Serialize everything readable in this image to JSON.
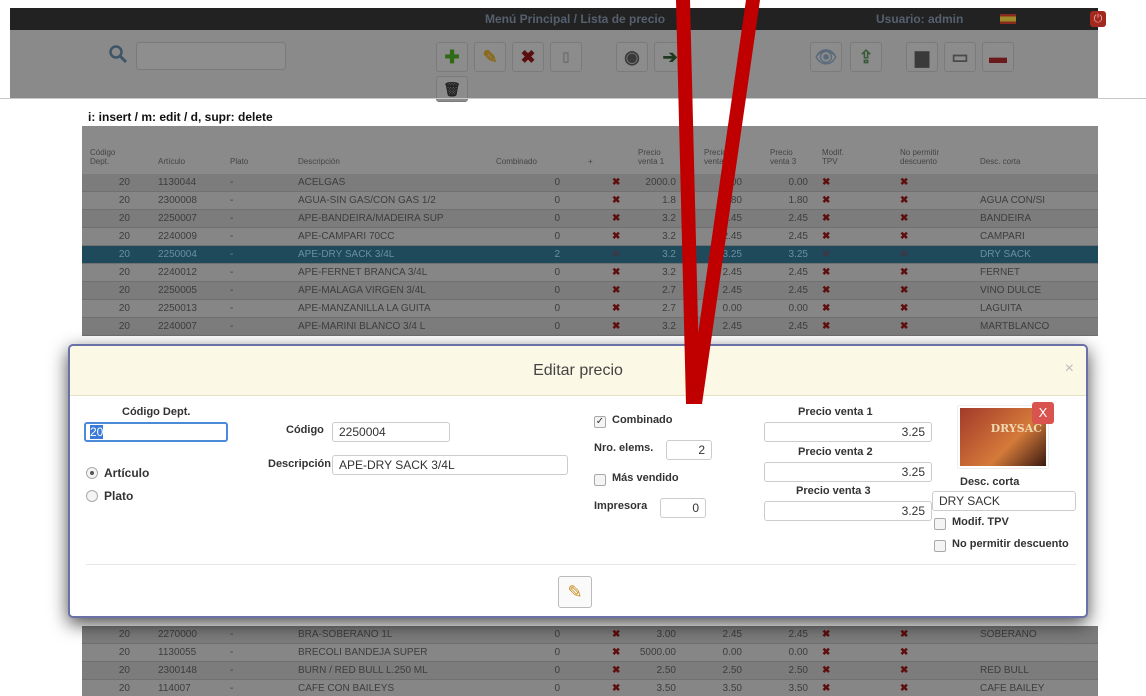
{
  "topbar": {
    "title": "Menú Principal / Lista de precio",
    "user": "Usuario: admin"
  },
  "hint": "i: insert / m: edit / d, supr: delete",
  "table": {
    "headers": [
      "Código Dept.",
      "Artículo",
      "Plato",
      "Descripción",
      "Combinado",
      "+",
      "Precio venta 1",
      "Precio venta 2",
      "Precio venta 3",
      "Modif. TPV",
      "No permitir descuento",
      "Desc. corta"
    ],
    "rows": [
      {
        "dept": "20",
        "art": "1130044",
        "plato": "-",
        "desc": "ACELGAS",
        "comb": "0",
        "p1": "2000.0",
        "p2": "0.00",
        "p3": "0.00",
        "corta": ""
      },
      {
        "dept": "20",
        "art": "2300008",
        "plato": "-",
        "desc": "AGUA-SIN GAS/CON GAS 1/2",
        "comb": "0",
        "p1": "1.8",
        "p2": "1.80",
        "p3": "1.80",
        "corta": "AGUA CON/SI"
      },
      {
        "dept": "20",
        "art": "2250007",
        "plato": "-",
        "desc": "APE-BANDEIRA/MADEIRA SUP",
        "comb": "0",
        "p1": "3.2",
        "p2": "2.45",
        "p3": "2.45",
        "corta": "BANDEIRA"
      },
      {
        "dept": "20",
        "art": "2240009",
        "plato": "-",
        "desc": "APE-CAMPARI 70CC",
        "comb": "0",
        "p1": "3.2",
        "p2": "2.45",
        "p3": "2.45",
        "corta": "CAMPARI"
      },
      {
        "dept": "20",
        "art": "2250004",
        "plato": "-",
        "desc": "APE-DRY SACK 3/4L",
        "comb": "2",
        "p1": "3.2",
        "p2": "3.25",
        "p3": "3.25",
        "corta": "DRY SACK",
        "selected": true
      },
      {
        "dept": "20",
        "art": "2240012",
        "plato": "-",
        "desc": "APE-FERNET BRANCA 3/4L",
        "comb": "0",
        "p1": "3.2",
        "p2": "2.45",
        "p3": "2.45",
        "corta": "FERNET"
      },
      {
        "dept": "20",
        "art": "2250005",
        "plato": "-",
        "desc": "APE-MALAGA VIRGEN 3/4L",
        "comb": "0",
        "p1": "2.7",
        "p2": "2.45",
        "p3": "2.45",
        "corta": "VINO DULCE"
      },
      {
        "dept": "20",
        "art": "2250013",
        "plato": "-",
        "desc": "APE-MANZANILLA LA GUITA",
        "comb": "0",
        "p1": "2.7",
        "p2": "0.00",
        "p3": "0.00",
        "corta": "LAGUITA"
      },
      {
        "dept": "20",
        "art": "2240007",
        "plato": "-",
        "desc": "APE-MARINI BLANCO 3/4 L",
        "comb": "0",
        "p1": "3.2",
        "p2": "2.45",
        "p3": "2.45",
        "corta": "MARTBLANCO"
      }
    ],
    "bottom_rows": [
      {
        "dept": "20",
        "art": "2270000",
        "plato": "-",
        "desc": "BRA-SOBERANO 1L",
        "comb": "0",
        "p1": "3.00",
        "p2": "2.45",
        "p3": "2.45",
        "corta": "SOBERANO"
      },
      {
        "dept": "20",
        "art": "1130055",
        "plato": "-",
        "desc": "BRECOLI BANDEJA SUPER",
        "comb": "0",
        "p1": "5000.00",
        "p2": "0.00",
        "p3": "0.00",
        "corta": ""
      },
      {
        "dept": "20",
        "art": "2300148",
        "plato": "-",
        "desc": "BURN / RED BULL L.250 ML",
        "comb": "0",
        "p1": "2.50",
        "p2": "2.50",
        "p3": "2.50",
        "corta": "RED BULL"
      },
      {
        "dept": "20",
        "art": "114007",
        "plato": "-",
        "desc": "CAFE CON BAILEYS",
        "comb": "0",
        "p1": "3.50",
        "p2": "3.50",
        "p3": "3.50",
        "corta": "CAFE BAILEY"
      }
    ]
  },
  "modal": {
    "title": "Editar precio",
    "close": "×",
    "codigo_dept_label": "Código Dept.",
    "codigo_dept_value": "20",
    "articulo_label": "Artículo",
    "plato_label": "Plato",
    "codigo_label": "Código",
    "codigo_value": "2250004",
    "descripcion_label": "Descripción",
    "descripcion_value": "APE-DRY SACK 3/4L",
    "combinado_label": "Combinado",
    "nro_elems_label": "Nro. elems.",
    "nro_elems_value": "2",
    "mas_vendido_label": "Más vendido",
    "impresora_label": "Impresora",
    "impresora_value": "0",
    "pv1_label": "Precio venta 1",
    "pv1_value": "3.25",
    "pv2_label": "Precio venta 2",
    "pv2_value": "3.25",
    "pv3_label": "Precio venta 3",
    "pv3_value": "3.25",
    "desc_corta_label": "Desc. corta",
    "desc_corta_value": "DRY SACK",
    "modif_tpv_label": "Modif. TPV",
    "no_desc_label": "No permitir descuento",
    "thumb_remove": "X",
    "thumb_text": "DRYSAC"
  },
  "colors": {
    "annotation": "#c00000",
    "x_mark": "#5e0e0e",
    "selected_row": "#1f4a5c"
  }
}
